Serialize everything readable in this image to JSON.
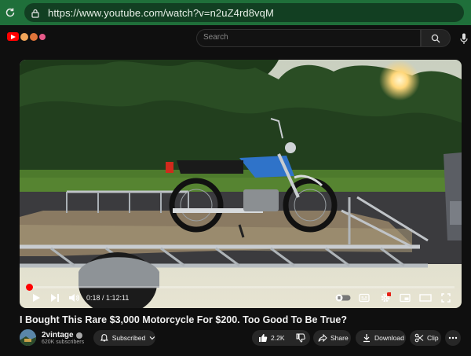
{
  "browser": {
    "url": "https://www.youtube.com/watch?v=n2uZ4rd8vqM"
  },
  "youtube_header": {
    "search_placeholder": "Search"
  },
  "player": {
    "current_time": "0:18",
    "duration": "1:12:11",
    "time_display": "0:18 / 1:12:11",
    "progress_fraction": 0.0042,
    "accent_color": "#ff0000"
  },
  "video": {
    "title": "I Bought This Rare $3,000 Motorcycle For $200. Too Good To Be True?",
    "channel_name": "2vintage",
    "subscribers": "620K subscribers"
  },
  "actions": {
    "subscribe_label": "Subscribed",
    "like_count": "2.2K",
    "share_label": "Share",
    "download_label": "Download",
    "clip_label": "Clip"
  },
  "icons": [
    "reload-icon",
    "lock-icon",
    "youtube-logo",
    "search-icon",
    "microphone-icon",
    "play-icon",
    "next-icon",
    "volume-icon",
    "autoplay-toggle",
    "subtitles-icon",
    "settings-icon",
    "miniplayer-icon",
    "theater-icon",
    "fullscreen-icon",
    "bell-icon",
    "like-icon",
    "dislike-icon",
    "share-icon",
    "download-icon",
    "scissors-icon",
    "more-icon"
  ]
}
